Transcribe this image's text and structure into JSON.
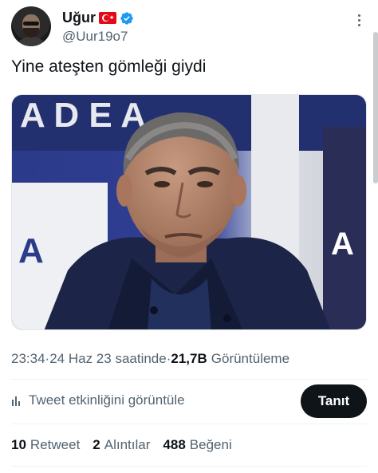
{
  "author": {
    "display_name": "Uğur",
    "handle": "@Uur19o7",
    "flag_icon": "turkey-flag-icon",
    "verified_icon": "verified-badge-icon",
    "verified_color": "#1d9bf0"
  },
  "tweet": {
    "text": "Yine ateşten gömleği giydi",
    "media_alt": "photo"
  },
  "meta": {
    "time": "23:34",
    "separator": " · ",
    "date": "24 Haz 23 saatinde",
    "views_count": "21,7B",
    "views_label": "Görüntüleme"
  },
  "actions": {
    "analytics_label": "Tweet etkinliğini görüntüle",
    "follow_label": "Tanıt"
  },
  "stats": {
    "retweets_count": "10",
    "retweets_label": "Retweet",
    "quotes_count": "2",
    "quotes_label": "Alıntılar",
    "likes_count": "488",
    "likes_label": "Beğeni"
  },
  "colors": {
    "text_primary": "#0f1419",
    "text_secondary": "#536471",
    "button_bg": "#0f1419"
  }
}
